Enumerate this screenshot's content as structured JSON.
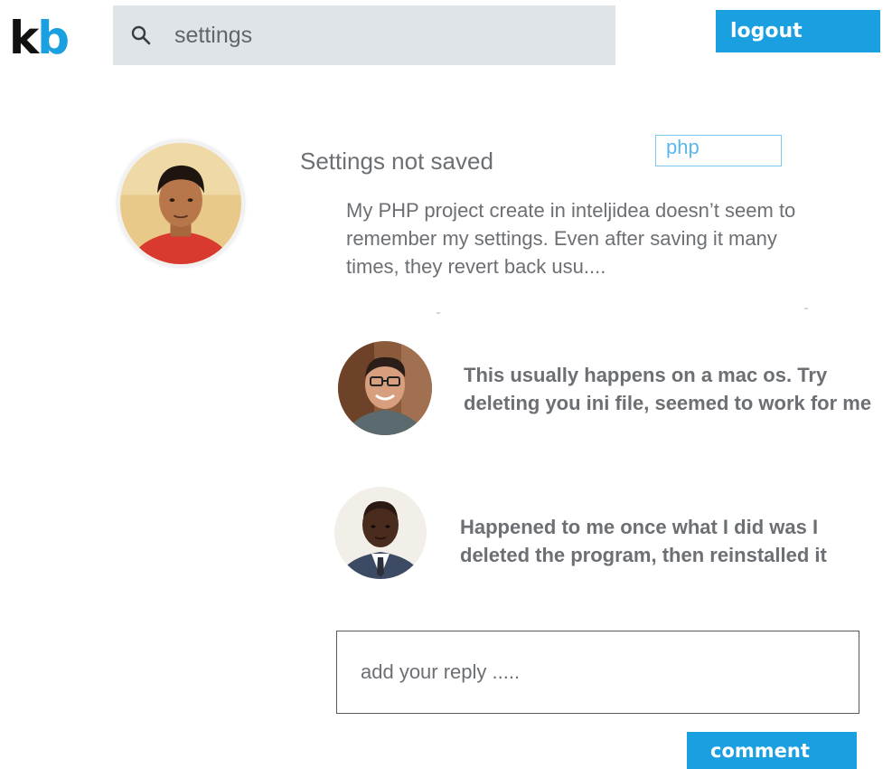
{
  "header": {
    "logo": {
      "k": "k",
      "b": "b"
    },
    "search": {
      "value": "settings",
      "icon": "search-icon"
    },
    "logout_label": "logout"
  },
  "post": {
    "title": "Settings not saved",
    "tag": "php",
    "body": "My PHP project create in inteljidea doesn’t seem to remember my settings. Even after saving it many times, they revert back usu...."
  },
  "replies": [
    {
      "text": "This usually happens on a mac os. Try deleting you ini file, seemed to work for me"
    },
    {
      "text": "Happened to me once what I did was I deleted the program, then reinstalled it"
    }
  ],
  "reply_box": {
    "placeholder": "add your reply ....."
  },
  "comment_label": "comment",
  "colors": {
    "accent": "#1a9fe0",
    "search_bg": "#dfe4e8",
    "text": "#6c6f73"
  }
}
